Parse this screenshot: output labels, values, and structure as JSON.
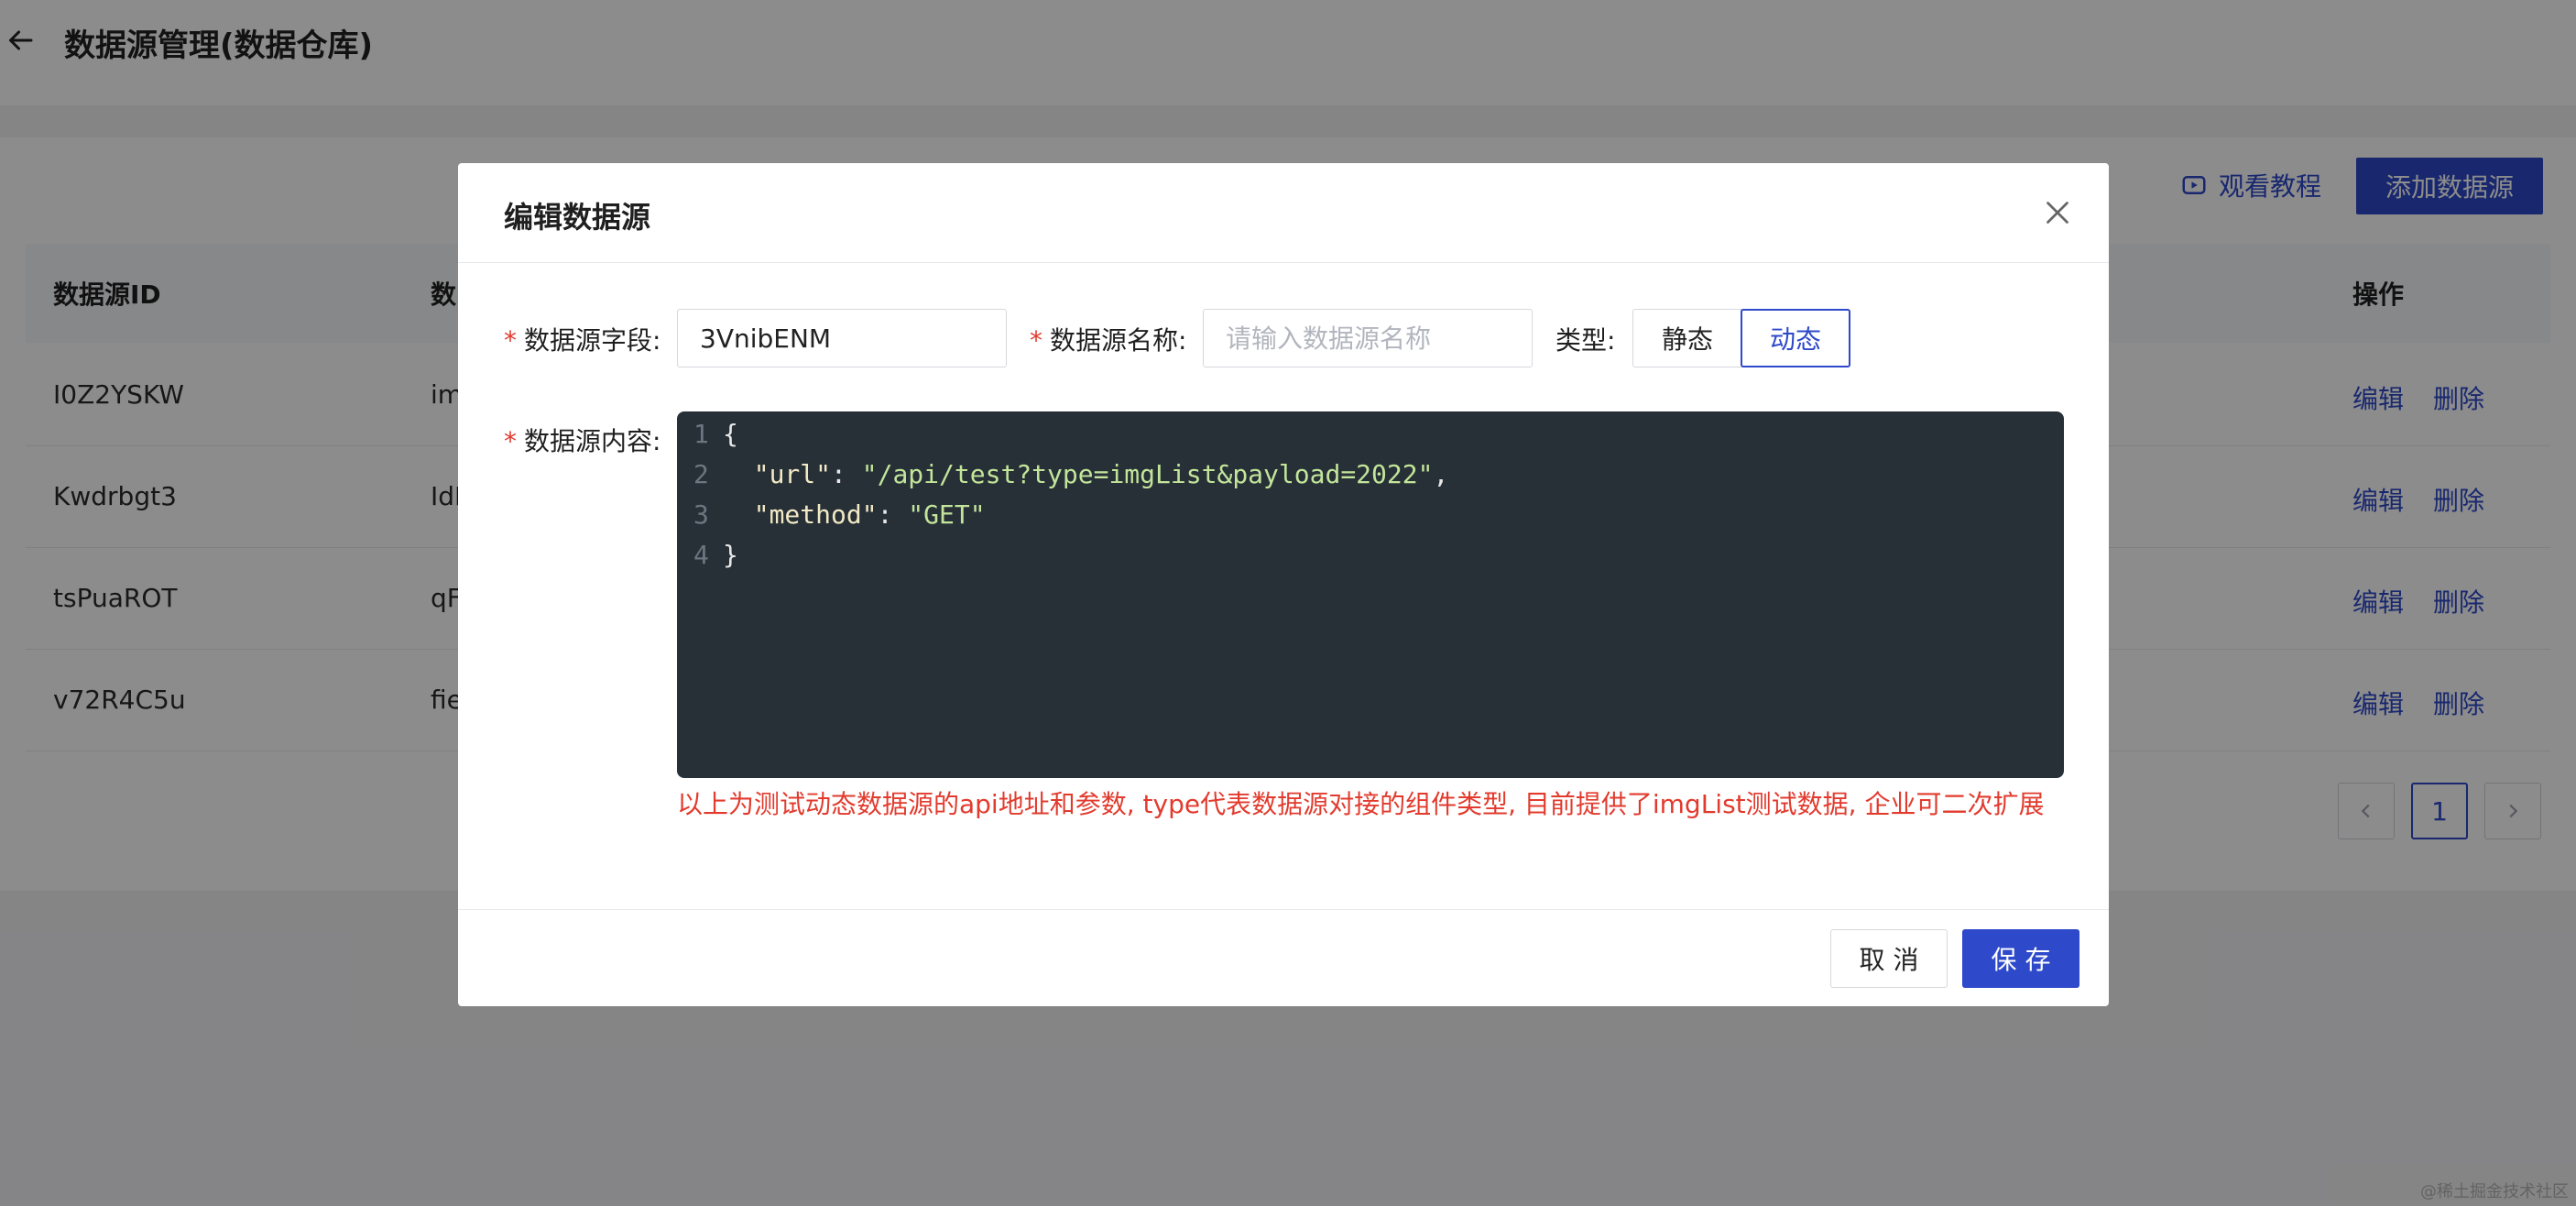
{
  "header": {
    "title": "数据源管理(数据仓库)"
  },
  "toolbar": {
    "tutorial_label": "观看教程",
    "add_label": "添加数据源"
  },
  "table": {
    "columns": {
      "id": "数据源ID",
      "name_partial": "数",
      "actions": "操作"
    },
    "rows": [
      {
        "id": "I0Z2YSKW",
        "name_partial": "im",
        "edit": "编辑",
        "delete": "删除"
      },
      {
        "id": "Kwdrbgt3",
        "name_partial": "IdI",
        "edit": "编辑",
        "delete": "删除"
      },
      {
        "id": "tsPuaROT",
        "name_partial": "qF",
        "edit": "编辑",
        "delete": "删除"
      },
      {
        "id": "v72R4C5u",
        "name_partial": "fie",
        "edit": "编辑",
        "delete": "删除"
      }
    ]
  },
  "pagination": {
    "current": "1"
  },
  "modal": {
    "title": "编辑数据源",
    "field_label": "数据源字段:",
    "field_value": "3VnibENM",
    "name_label": "数据源名称:",
    "name_placeholder": "请输入数据源名称",
    "type_label": "类型:",
    "type_static": "静态",
    "type_dynamic": "动态",
    "type_selected": "动态",
    "content_label": "数据源内容:",
    "code": {
      "line_numbers": [
        "1",
        "2",
        "3",
        "4"
      ],
      "open_brace": "{",
      "url_key": "\"url\"",
      "url_value": "\"/api/test?type=imgList&payload=2022\"",
      "method_key": "\"method\"",
      "method_value": "\"GET\"",
      "close_brace": "}"
    },
    "hint": "以上为测试动态数据源的api地址和参数, type代表数据源对接的组件类型, 目前提供了imgList测试数据, 企业可二次扩展",
    "cancel_label": "取 消",
    "save_label": "保 存"
  },
  "watermark": "@稀土掘金技术社区",
  "colors": {
    "primary": "#2e49c9",
    "required": "#e23b2e",
    "editor_bg": "#272f37"
  }
}
